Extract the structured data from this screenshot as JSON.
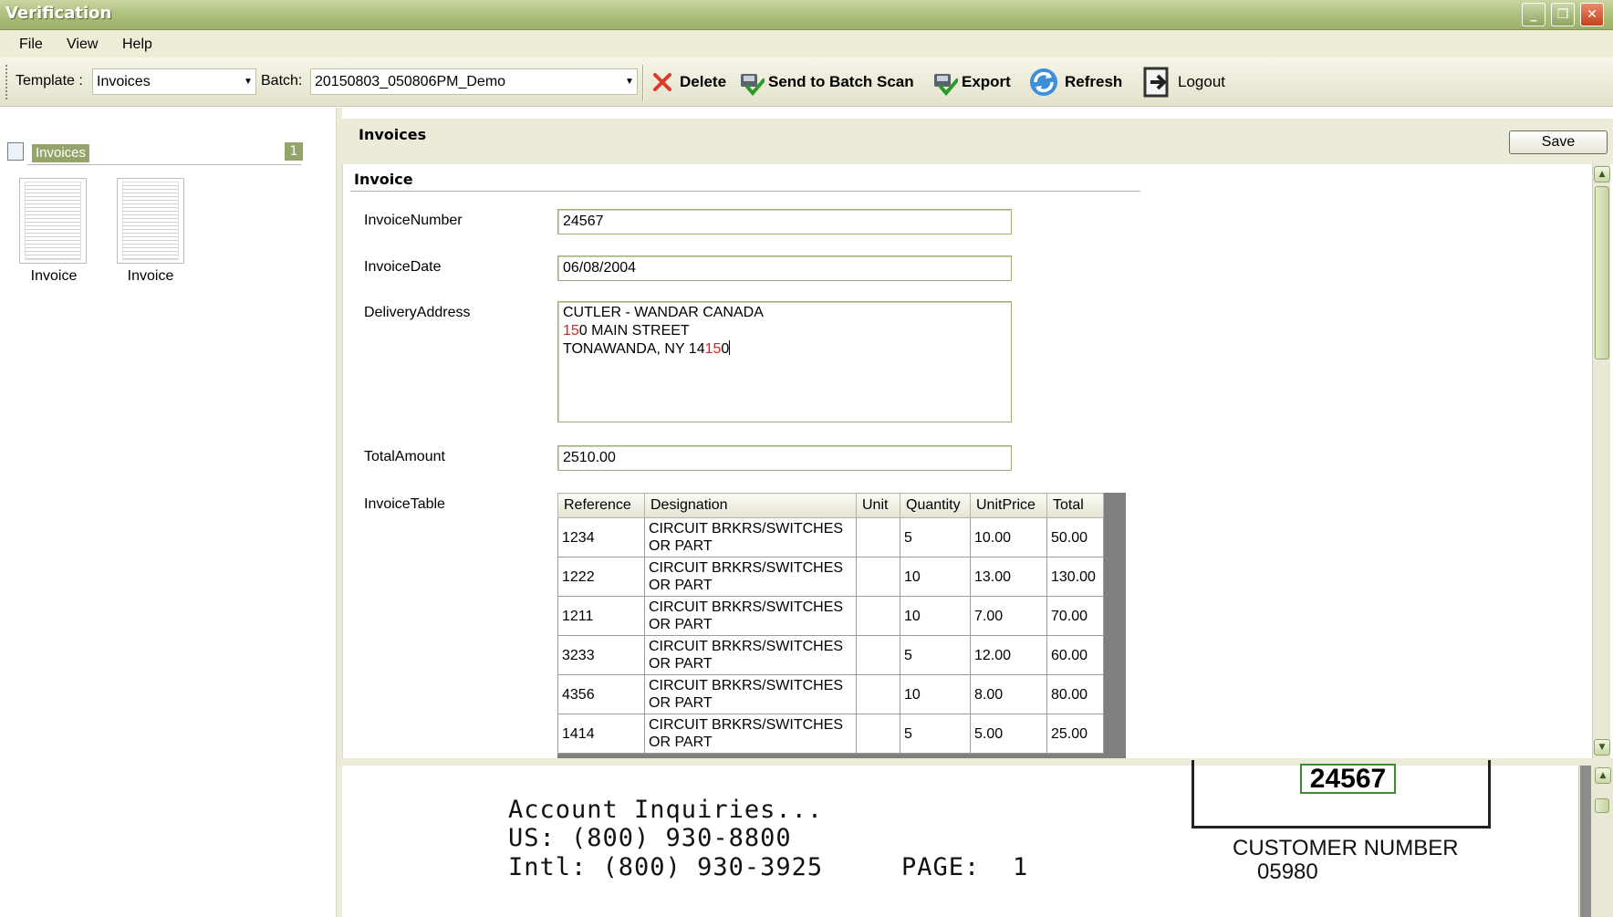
{
  "window": {
    "title": "Verification",
    "controls": {
      "minimize": "minimize-icon",
      "restore": "restore-icon",
      "close": "close-icon"
    }
  },
  "menu": {
    "items": [
      "File",
      "View",
      "Help"
    ]
  },
  "toolbar": {
    "template_label": "Template :",
    "template_value": "Invoices",
    "batch_label": "Batch:",
    "batch_value": "20150803_050806PM_Demo",
    "delete_label": "Delete",
    "send_label": "Send to Batch Scan",
    "export_label": "Export",
    "refresh_label": "Refresh",
    "logout_label": "Logout"
  },
  "tree": {
    "label": "Invoices",
    "count": "1",
    "thumbnails": [
      {
        "label": "Invoice"
      },
      {
        "label": "Invoice"
      }
    ]
  },
  "panel": {
    "title": "Invoices",
    "save_label": "Save",
    "section_title": "Invoice"
  },
  "fields": {
    "invoice_number": {
      "label": "InvoiceNumber",
      "value": "24567"
    },
    "invoice_date": {
      "label": "InvoiceDate",
      "value": "06/08/2004"
    },
    "delivery_address": {
      "label": "DeliveryAddress",
      "line1": "CUTLER - WANDAR CANADA",
      "line2_red": "15",
      "line2_rest": "0 MAIN STREET",
      "line3_pre": "TONAWANDA, NY 14",
      "line3_red": "15",
      "line3_post": "0"
    },
    "total_amount": {
      "label": "TotalAmount",
      "value": "2510.00"
    },
    "invoice_table": {
      "label": "InvoiceTable"
    }
  },
  "table": {
    "columns": [
      "Reference",
      "Designation",
      "Unit",
      "Quantity",
      "UnitPrice",
      "Total"
    ],
    "rows": [
      {
        "reference": "1234",
        "designation_1": "CIRCUIT BRKRS/SWITCHES",
        "designation_2": "OR PART",
        "unit": "",
        "quantity": "5",
        "unit_price": "10.00",
        "total": "50.00"
      },
      {
        "reference": "1222",
        "designation_1": "CIRCUIT BRKRS/SWITCHES",
        "designation_2": "OR PART",
        "unit": "",
        "quantity": "10",
        "unit_price": "13.00",
        "total": "130.00"
      },
      {
        "reference": "1211",
        "designation_1": "CIRCUIT BRKRS/SWITCHES",
        "designation_2": "OR PART",
        "unit": "",
        "quantity": "10",
        "unit_price": "7.00",
        "total": "70.00"
      },
      {
        "reference": "3233",
        "designation_1": "CIRCUIT BRKRS/SWITCHES",
        "designation_2": "OR PART",
        "unit": "",
        "quantity": "5",
        "unit_price": "12.00",
        "total": "60.00"
      },
      {
        "reference": "4356",
        "designation_1": "CIRCUIT BRKRS/SWITCHES",
        "designation_2": "OR PART",
        "unit": "",
        "quantity": "10",
        "unit_price": "8.00",
        "total": "80.00"
      },
      {
        "reference": "1414",
        "designation_1": "CIRCUIT BRKRS/SWITCHES",
        "designation_2": "OR PART",
        "unit": "",
        "quantity": "5",
        "unit_price": "5.00",
        "total": "25.00"
      }
    ]
  },
  "scan": {
    "line1": "Account Inquiries...",
    "line2": "US: (800) 930-8800",
    "line3": "Intl: (800) 930-3925",
    "page_label": "PAGE:",
    "page_value": "1",
    "highlight_number": "24567",
    "customer_label": "CUSTOMER NUMBER",
    "customer_value": "05980"
  },
  "colors": {
    "accent": "#93a56a",
    "title_bar": "#a8bc78",
    "highlight_text": "#e02020"
  }
}
